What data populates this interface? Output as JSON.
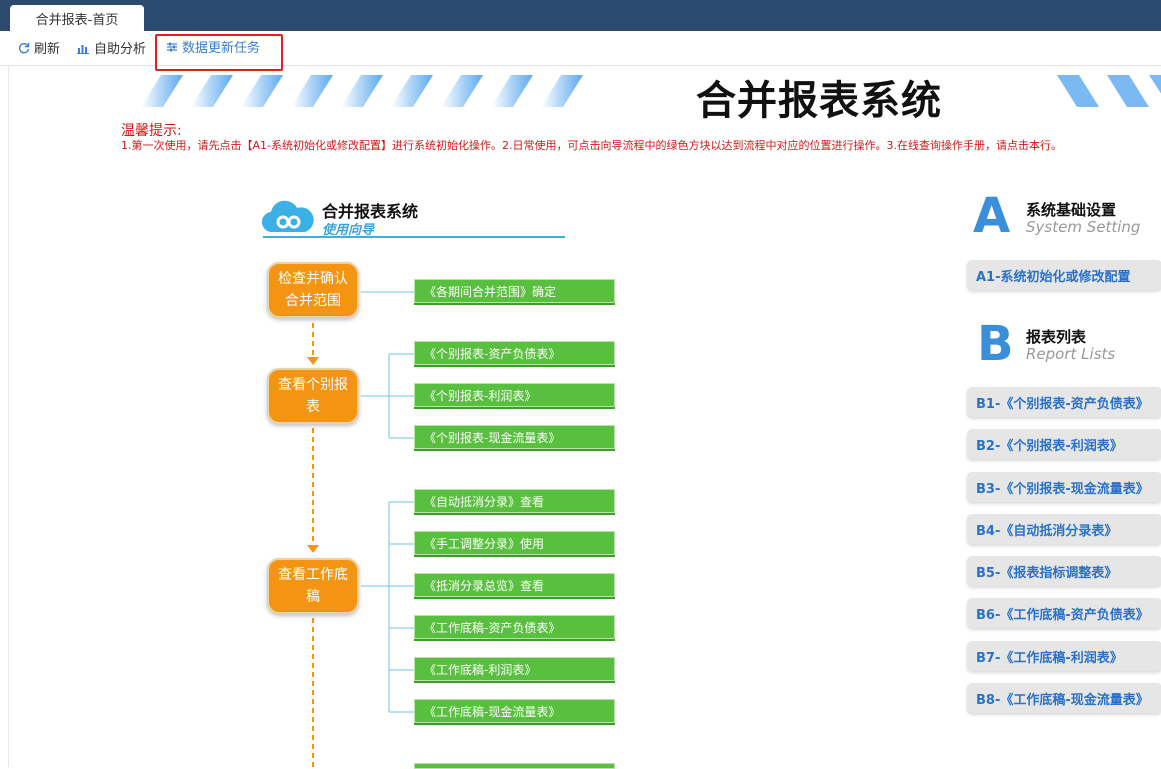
{
  "tab": {
    "title": "合并报表-首页"
  },
  "toolbar": {
    "refresh_label": "刷新",
    "analysis_label": "自助分析",
    "update_label": "数据更新任务"
  },
  "header": {
    "title": "合并报表系统"
  },
  "tips": {
    "heading": "温馨提示:",
    "body": "1.第一次使用，请先点击【A1-系统初始化或修改配置】进行系统初始化操作。2.日常使用，可点击向导流程中的绿色方块以达到流程中对应的位置进行操作。3.在线查询操作手册，请点击本行。"
  },
  "guide": {
    "title": "合并报表系统",
    "subtitle": "使用向导"
  },
  "steps": [
    {
      "label": "检查并确认合并范围"
    },
    {
      "label": "查看个别报表"
    },
    {
      "label": "查看工作底稿"
    }
  ],
  "green_items": [
    "《各期间合并范围》确定",
    "《个别报表-资产负债表》",
    "《个别报表-利润表》",
    "《个别报表-现金流量表》",
    "《自动抵消分录》查看",
    "《手工调整分录》使用",
    "《抵消分录总览》查看",
    "《工作底稿-资产负债表》",
    "《工作底稿-利润表》",
    "《工作底稿-现金流量表》"
  ],
  "section_a": {
    "letter": "A",
    "title": "系统基础设置",
    "subtitle": "System Setting",
    "items": [
      "A1-系统初始化或修改配置"
    ]
  },
  "section_b": {
    "letter": "B",
    "title": "报表列表",
    "subtitle": "Report Lists",
    "items": [
      "B1-《个别报表-资产负债表》",
      "B2-《个别报表-利润表》",
      "B3-《个别报表-现金流量表》",
      "B4-《自动抵消分录表》",
      "B5-《报表指标调整表》",
      "B6-《工作底稿-资产负债表》",
      "B7-《工作底稿-利润表》",
      "B8-《工作底稿-现金流量表》"
    ]
  },
  "colors": {
    "accent": "#3a7fd5",
    "step_orange": "#f39512",
    "green_block": "#59bf3e",
    "tip_red": "#d01818",
    "topbar": "#2b4a6f"
  }
}
